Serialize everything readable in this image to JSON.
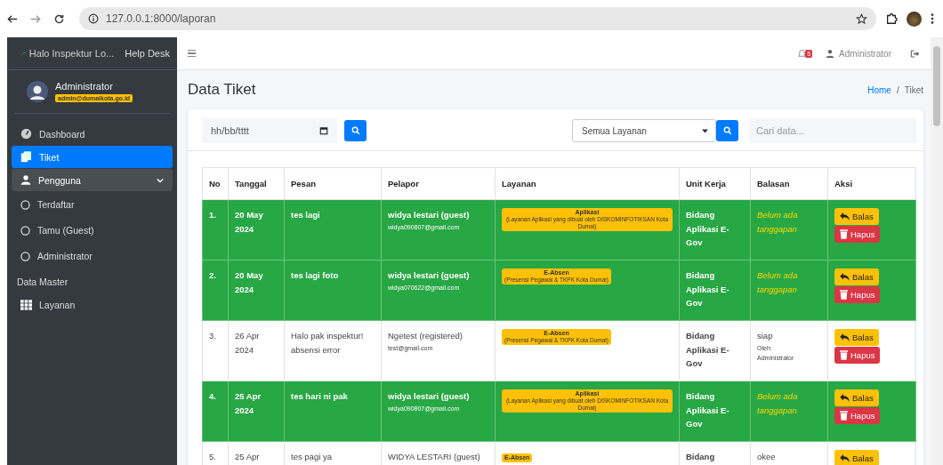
{
  "browser": {
    "url": "127.0.0.1:8000/laporan"
  },
  "sidebar": {
    "brand": "Halo Inspektur Lo...",
    "brand_suffix": "Help Desk",
    "user": {
      "name": "Administrator",
      "email": "admin@dumaikota.go.id"
    },
    "items": [
      {
        "kind": "link",
        "label": "Dashboard",
        "selected": false
      },
      {
        "kind": "link",
        "label": "Tiket",
        "selected": true
      },
      {
        "kind": "group",
        "label": "Pengguna",
        "selected": false,
        "expanded": true,
        "children": [
          {
            "kind": "sub",
            "label": "Terdaftar",
            "selected": false
          },
          {
            "kind": "sub",
            "label": "Tamu (Guest)",
            "selected": false
          },
          {
            "kind": "sub",
            "label": "Administrator",
            "selected": false
          }
        ]
      },
      {
        "kind": "header",
        "label": "Data Master"
      },
      {
        "kind": "link",
        "label": "Layanan",
        "selected": false
      }
    ]
  },
  "navbar": {
    "notifications": "5",
    "user": "Administrator"
  },
  "page": {
    "title": "Data Tiket",
    "breadcrumb_separator": "/",
    "breadcrumb": [
      {
        "label": "Home",
        "link": true
      },
      {
        "label": "Tiket",
        "link": false
      }
    ]
  },
  "filters": {
    "date": {
      "placeholder": "hh/bb/tttt"
    },
    "service": {
      "value": "Semua Layanan"
    },
    "search": {
      "placeholder": "Cari data..."
    }
  },
  "table": {
    "columns": [
      "No",
      "Tanggal",
      "Pesan",
      "Pelapor",
      "Layanan",
      "Unit Kerja",
      "Balasan",
      "Aksi"
    ],
    "rows": [
      {
        "highlight": true,
        "no": "1.",
        "date": [
          "20 May",
          "2024"
        ],
        "message": "tes lagi",
        "reporter": "widya lestari (guest)",
        "email": "widya090807@gmail.com",
        "service": {
          "name": "Aplikasi",
          "desc": "(Layanan Aplikasi yang dibuat oleh DISKOMINFOTIKSAN Kota Dumai)"
        },
        "unit": "Bidang Aplikasi E-Gov",
        "reply": {
          "answered": false,
          "text": "Belum ada tanggapan"
        },
        "actions": [
          "Balas",
          "Hapus"
        ]
      },
      {
        "highlight": true,
        "no": "2.",
        "date": [
          "20 May",
          "2024"
        ],
        "message": "tes lagi foto",
        "reporter": "widya lestari (guest)",
        "email": "widya070622@gmail.com",
        "service": {
          "name": "E-Absen",
          "desc": "(Presensi Pegawai & TKPK Kota Dumai)"
        },
        "unit": "Bidang Aplikasi E-Gov",
        "reply": {
          "answered": false,
          "text": "Belum ada tanggapan"
        },
        "actions": [
          "Balas",
          "Hapus"
        ]
      },
      {
        "highlight": false,
        "no": "3.",
        "date": [
          "26 Apr",
          "2024"
        ],
        "message": "Halo pak inspektur! absensi error",
        "reporter": "Ngetest (registered)",
        "email": "test@gmail.com",
        "service": {
          "name": "E-Absen",
          "desc": "(Presensi Pegawai & TKPK Kota Dumai)"
        },
        "unit": "Bidang Aplikasi E-Gov",
        "reply": {
          "answered": true,
          "text": "siap",
          "by_label": "Oleh:",
          "by": "Administrator"
        },
        "actions": [
          "Balas",
          "Hapus"
        ]
      },
      {
        "highlight": true,
        "no": "4.",
        "date": [
          "25 Apr",
          "2024"
        ],
        "message": "tes hari ni pak",
        "reporter": "widya lestari (guest)",
        "email": "widya090807@gmail.com",
        "service": {
          "name": "Aplikasi",
          "desc": "(Layanan Aplikasi yang dibuat oleh DISKOMINFOTIKSAN Kota Dumai)"
        },
        "unit": "Bidang Aplikasi E-Gov",
        "reply": {
          "answered": false,
          "text": "Belum ada tanggapan"
        },
        "actions": [
          "Balas",
          "Hapus"
        ]
      },
      {
        "highlight": false,
        "no": "5.",
        "date": [
          "25 Apr"
        ],
        "message": "tes pagi ya",
        "reporter": "WIDYA LESTARI (guest)",
        "service": {
          "name": "E-Absen"
        },
        "unit": "Bidang",
        "reply": {
          "answered": true,
          "text": "okee"
        },
        "actions": [
          "Balas"
        ]
      }
    ]
  }
}
